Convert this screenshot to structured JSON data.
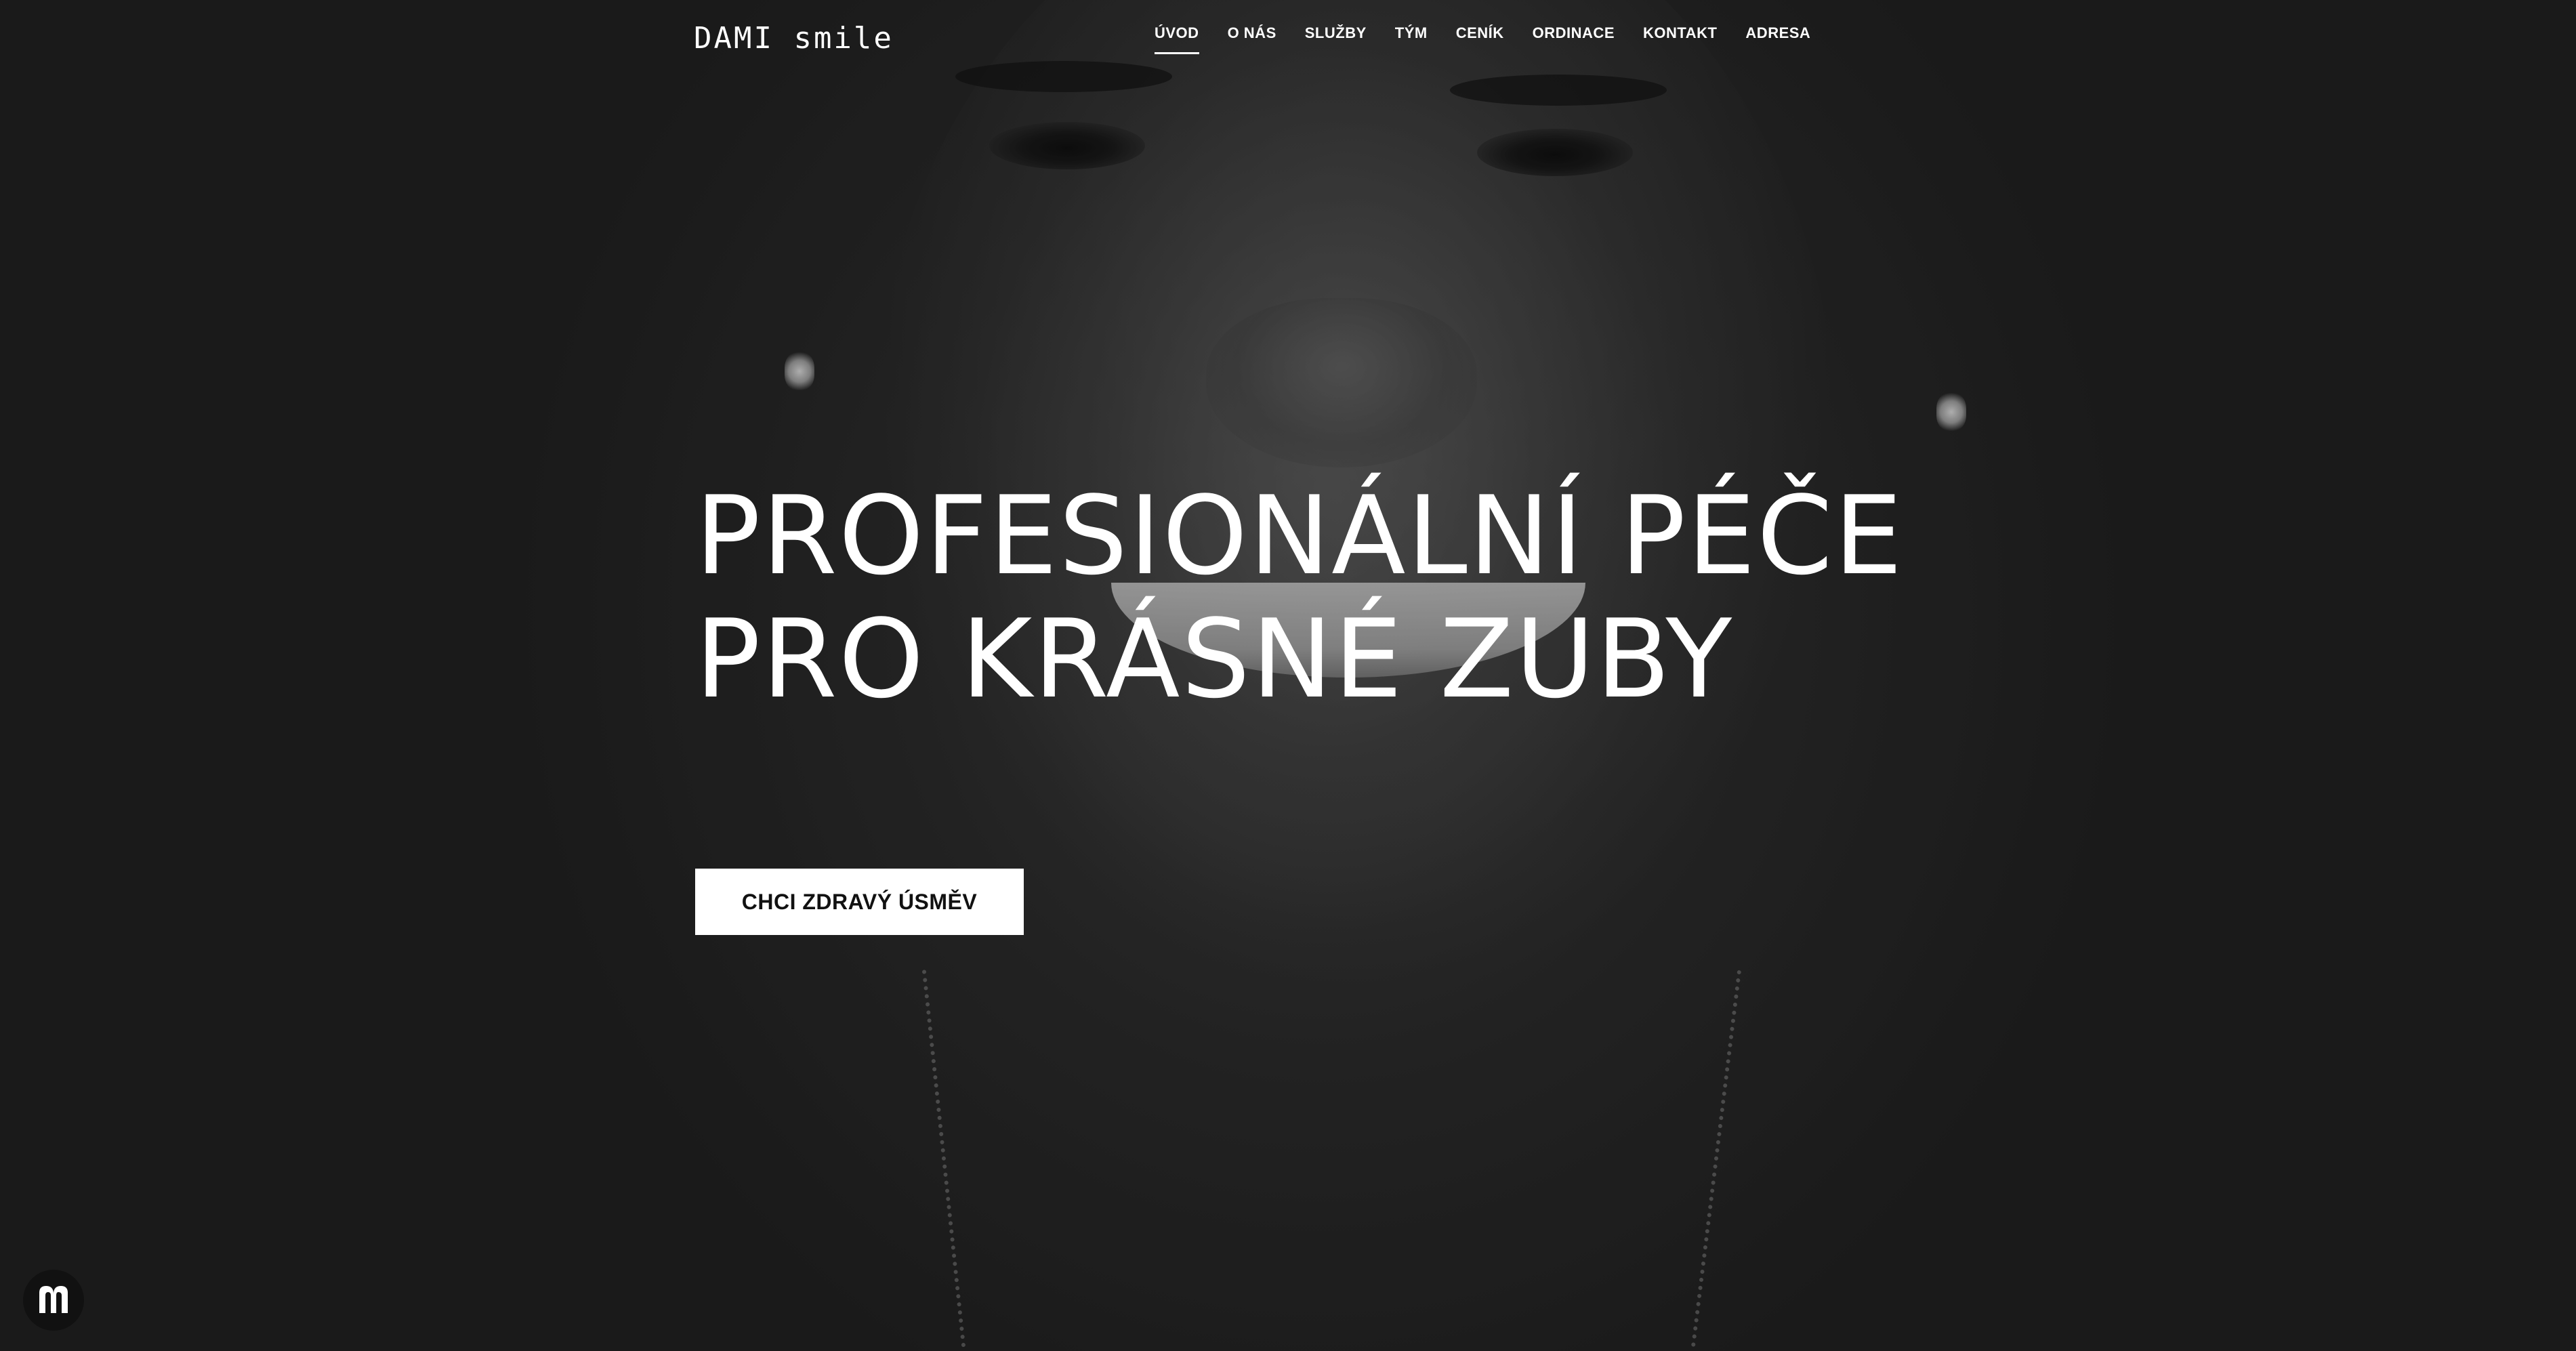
{
  "site": {
    "logo_text": "DAMI smile"
  },
  "nav": {
    "items": [
      {
        "label": "ÚVOD",
        "active": true
      },
      {
        "label": "O NÁS"
      },
      {
        "label": "SLUŽBY"
      },
      {
        "label": "TÝM"
      },
      {
        "label": "CENÍK"
      },
      {
        "label": "ORDINACE"
      },
      {
        "label": "KONTAKT"
      },
      {
        "label": "ADRESA"
      }
    ]
  },
  "hero": {
    "headline_line1": "PROFESIONÁLNÍ PÉČE",
    "headline_line2": "PRO KRÁSNÉ ZUBY",
    "cta_label": "CHCI ZDRAVÝ ÚSMĚV",
    "background_icon": "smiling-woman-photo"
  },
  "badge": {
    "icon": "m-logo-icon"
  },
  "colors": {
    "text": "#ffffff",
    "background": "#2a2a2a",
    "cta_bg": "#ffffff",
    "cta_text": "#111111"
  }
}
